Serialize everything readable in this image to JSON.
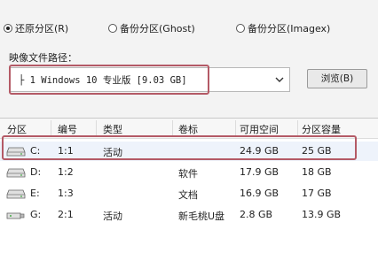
{
  "mode_options": [
    {
      "label": "还原分区(R)",
      "selected": true
    },
    {
      "label": "备份分区(Ghost)",
      "selected": false
    },
    {
      "label": "备份分区(Imagex)",
      "selected": false
    }
  ],
  "image_path": {
    "label": "映像文件路径：",
    "selected_value": "├ 1 Windows 10 专业版 [9.03 GB]"
  },
  "browse_button": "浏览(B)",
  "partition_table": {
    "columns": [
      "分区",
      "编号",
      "类型",
      "卷标",
      "可用空间",
      "分区容量"
    ],
    "rows": [
      {
        "drive": "C:",
        "number": "1:1",
        "type": "活动",
        "label": "",
        "free": "24.9 GB",
        "size": "25 GB",
        "icon": "drive-icon"
      },
      {
        "drive": "D:",
        "number": "1:2",
        "type": "",
        "label": "软件",
        "free": "17.9 GB",
        "size": "18 GB",
        "icon": "drive-icon"
      },
      {
        "drive": "E:",
        "number": "1:3",
        "type": "",
        "label": "文档",
        "free": "16.9 GB",
        "size": "17 GB",
        "icon": "drive-icon"
      },
      {
        "drive": "G:",
        "number": "2:1",
        "type": "活动",
        "label": "新毛桃U盘",
        "free": "2.8 GB",
        "size": "13.9 GB",
        "icon": "usb-drive-icon"
      }
    ]
  },
  "colors": {
    "highlight_border": "#b45a66",
    "selected_row": "#eef3fb"
  }
}
